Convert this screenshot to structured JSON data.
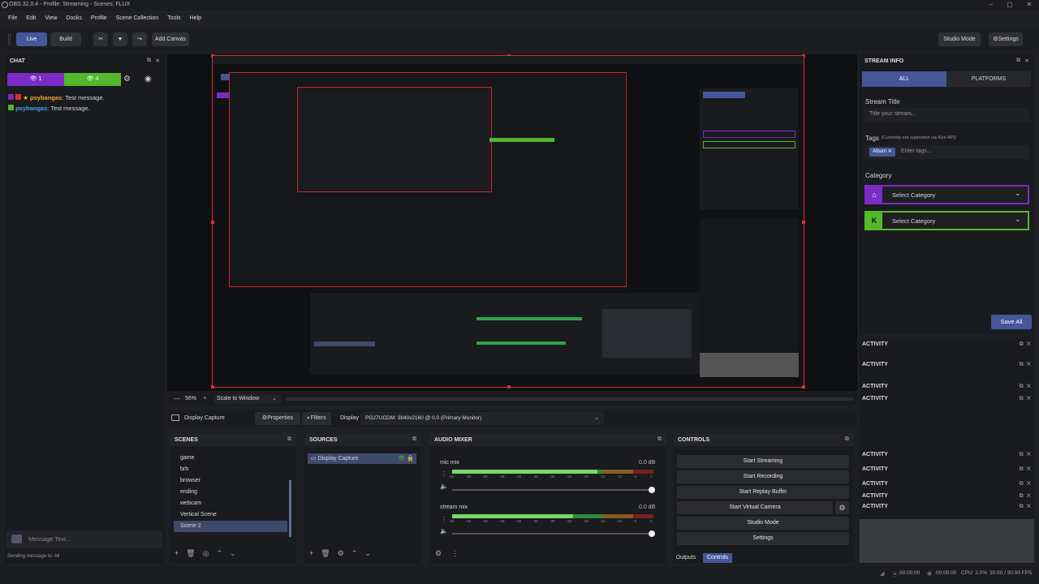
{
  "window": {
    "title": "OBS 32.0.4 - Profile: Streaming - Scenes: FLUX",
    "min": "–",
    "max": "▢",
    "close": "✕"
  },
  "menu": [
    "File",
    "Edit",
    "View",
    "Docks",
    "Profile",
    "Scene Collection",
    "Tools",
    "Help"
  ],
  "toolbar": {
    "live": "Live",
    "build": "Build",
    "add_canvas": "Add Canvas",
    "studio_mode": "Studio Mode",
    "settings": "Settings"
  },
  "chat": {
    "title": "CHAT",
    "twitch_count": "1",
    "kick_count": "4",
    "messages": [
      {
        "user": "psybangas",
        "text": ": Test message."
      },
      {
        "user": "psybangas",
        "text": ": Test message."
      }
    ],
    "input_placeholder": "Message Text...",
    "sending_to": "Sending message to: All"
  },
  "preview": {
    "zoom": "56%",
    "scale_mode": "Scale to Window"
  },
  "source_bar": {
    "source_name": "Display Capture",
    "properties": "Properties",
    "filters": "Filters",
    "display_label": "Display",
    "display_value": "PG27UCDM: 3840x2160 @ 0,0 (Primary Monitor)"
  },
  "scenes": {
    "title": "SCENES",
    "items": [
      "game",
      "brb",
      "browser",
      "ending",
      "webcam",
      "Vertical Scene",
      "Scene 2"
    ],
    "selected": "Scene 2"
  },
  "sources": {
    "title": "SOURCES",
    "items": [
      "Display Capture"
    ]
  },
  "mixer": {
    "title": "AUDIO MIXER",
    "channels": [
      {
        "name": "mic mix",
        "db": "0.0 dB",
        "level": 0.72
      },
      {
        "name": "stream mix",
        "db": "0.0 dB",
        "level": 0.6
      }
    ],
    "ticks": [
      "-60",
      "-55",
      "-50",
      "-45",
      "-40",
      "-35",
      "-30",
      "-25",
      "-20",
      "-15",
      "-10",
      "-5",
      "0"
    ]
  },
  "controls": {
    "title": "CONTROLS",
    "buttons": [
      "Start Streaming",
      "Start Recording",
      "Start Replay Buffer",
      "Start Virtual Camera",
      "Studio Mode",
      "Settings"
    ],
    "tabs": [
      "Outputs",
      "Controls"
    ]
  },
  "stream_info": {
    "title": "STREAM INFO",
    "tab_all": "ALL",
    "tab_platforms": "PLATFORMS",
    "stream_title_label": "Stream Title",
    "stream_title_placeholder": "Title your stream...",
    "tags_label": "Tags",
    "tags_note": "(Currently not supported via Kick API)",
    "tag": "Album",
    "tags_placeholder": "Enter tags...",
    "category_label": "Category",
    "twitch_category": "Select Category",
    "kick_category": "Select Category",
    "save_all": "Save All"
  },
  "activity": {
    "title": "ACTIVITY"
  },
  "status": {
    "time1": "00:00:00",
    "time2": "00:00:00",
    "cpu": "CPU: 2.0%",
    "fps": "30.00 / 30.00 FPS"
  },
  "colors": {
    "twitch": "#7a2cc5",
    "kick": "#53b82a",
    "accent": "#45579a",
    "record_red": "#d63031"
  }
}
